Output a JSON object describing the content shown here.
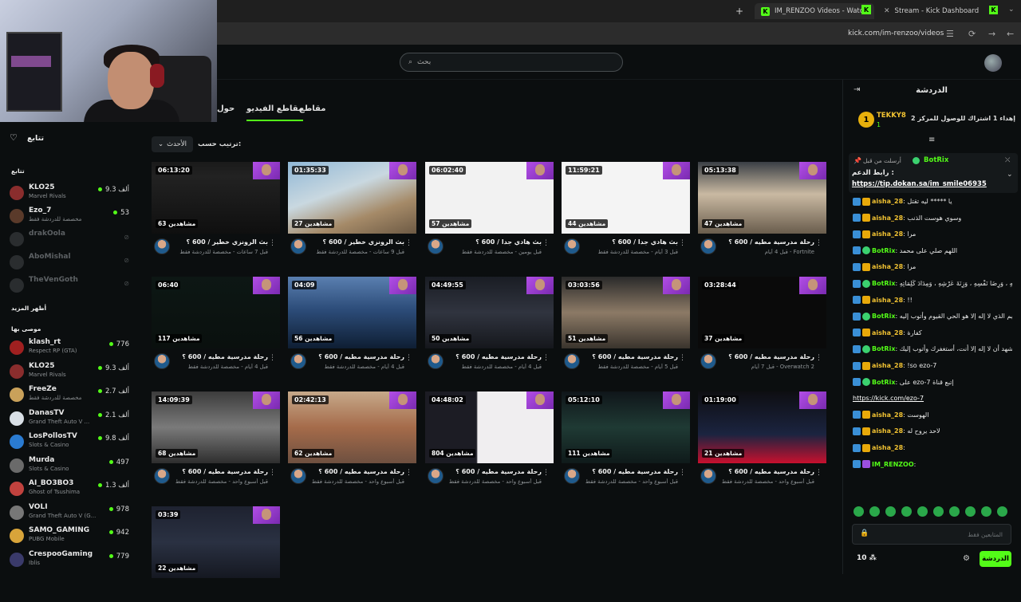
{
  "browser": {
    "tabs": [
      {
        "label": "IM_RENZOO Videos - Watch On",
        "active": true
      },
      {
        "label": "Stream - Kick Dashboard",
        "active": false
      }
    ],
    "new_tab": "+",
    "url": "kick.com/im-renzoo/videos"
  },
  "header": {
    "search_placeholder": "بحث"
  },
  "channel_tabs": {
    "about": "حول",
    "videos": "مقاطع الفيديو",
    "clips": "مقاطع"
  },
  "sort": {
    "label": "ترتيب حسب:",
    "value": "الأحدث"
  },
  "sidebar": {
    "following_title": "تتابع",
    "following_label": "تتابع",
    "show_more": "أظهر المزيد",
    "recommended_label": "موصى بها",
    "following": [
      {
        "name": "KLO25",
        "category": "Marvel Rivals",
        "viewers": "9.3 ألف",
        "live": true,
        "color": "#8a2d2d"
      },
      {
        "name": "Ezo_7",
        "category": "مخصصة للدردشة فقط",
        "viewers": "53",
        "live": true,
        "color": "#5a3a2a"
      },
      {
        "name": "drakOola",
        "category": "",
        "viewers": "",
        "live": false,
        "color": "#333"
      },
      {
        "name": "AboMishal",
        "category": "",
        "viewers": "",
        "live": false,
        "color": "#333"
      },
      {
        "name": "TheVenGoth",
        "category": "",
        "viewers": "",
        "live": false,
        "color": "#333"
      }
    ],
    "recommended": [
      {
        "name": "klash_rt",
        "category": "Respect RP (GTA)",
        "viewers": "776",
        "color": "#a02020"
      },
      {
        "name": "KLO25",
        "category": "Marvel Rivals",
        "viewers": "9.3 ألف",
        "color": "#8a2d2d"
      },
      {
        "name": "FreeZe",
        "category": "مخصصة للدردشة فقط",
        "viewers": "2.7 ألف",
        "color": "#c9a15a"
      },
      {
        "name": "DanasTV",
        "category": "Grand Theft Auto V ...",
        "viewers": "2.1 ألف",
        "color": "#d9e0e6"
      },
      {
        "name": "LosPollosTV",
        "category": "Slots & Casino",
        "viewers": "9.8 ألف",
        "color": "#2a7bd1"
      },
      {
        "name": "Murda",
        "category": "Slots & Casino",
        "viewers": "497",
        "color": "#6a6a6a"
      },
      {
        "name": "AI_BO3BO3",
        "category": "Ghost of Tsushima",
        "viewers": "1.3 ألف",
        "color": "#c1423e"
      },
      {
        "name": "VOLI",
        "category": "Grand Theft Auto V (G...",
        "viewers": "978",
        "color": "#777"
      },
      {
        "name": "SAMO_GAMING",
        "category": "PUBG Mobile",
        "viewers": "942",
        "color": "#d8a43a"
      },
      {
        "name": "CrespooGaming",
        "category": "Iblis",
        "viewers": "779",
        "color": "#3a3a6a"
      }
    ]
  },
  "videos": [
    {
      "duration": "06:13:20",
      "views": "63 مشاهدين",
      "title": "بث الرونزي خطير / 600 ؟",
      "sub": "قبل 7 ساعات - مخصصة للدردشة فقط",
      "bg": "linear-gradient(180deg,#1a1a1a 0%,#222 20%,#0f0f0f 100%)"
    },
    {
      "duration": "01:35:33",
      "views": "27 مشاهدين",
      "title": "بث الرونزي خطير / 600 ؟",
      "sub": "قبل 9 ساعات - مخصصة للدردشة فقط",
      "bg": "linear-gradient(160deg,#8fb7d6 0%,#c9d8e0 40%,#a58a68 70%,#6d5a44 100%)"
    },
    {
      "duration": "06:02:40",
      "views": "57 مشاهدين",
      "title": "بث هادي جدا / 600 ؟",
      "sub": "قبل يومين - مخصصة للدردشة فقط",
      "bg": "#f2f2f2"
    },
    {
      "duration": "11:59:21",
      "views": "44 مشاهدين",
      "title": "بث هادي جدا / 600 ؟",
      "sub": "قبل 3 أيام - مخصصة للدردشة فقط",
      "bg": "#f4f4f4"
    },
    {
      "duration": "05:13:38",
      "views": "47 مشاهدين",
      "title": "رحلة مدرسية مطيه / 600 ؟",
      "sub": "قبل 4 أيام - Fortnite",
      "bg": "linear-gradient(180deg,#3a3f45 0%,#c9b9a2 45%,#6a5d4d 100%)"
    },
    {
      "duration": "06:40",
      "views": "117 مشاهدين",
      "title": "رحلة مدرسية مطيه / 600 ؟",
      "sub": "قبل 4 أيام - مخصصة للدردشة فقط",
      "bg": "linear-gradient(180deg,#0d1714 0%,#0a100e 100%)"
    },
    {
      "duration": "04:09",
      "views": "56 مشاهدين",
      "title": "رحلة مدرسية مطيه / 600 ؟",
      "sub": "قبل 4 أيام - مخصصة للدردشة فقط",
      "bg": "linear-gradient(180deg,#5a7fb0 0%,#2d4d7a 45%,#0e1e33 100%)"
    },
    {
      "duration": "04:49:55",
      "views": "50 مشاهدين",
      "title": "رحلة مدرسية مطيه / 600 ؟",
      "sub": "قبل 4 أيام - مخصصة للدردشة فقط",
      "bg": "linear-gradient(180deg,#1a1d24 0%,#30343f 50%,#15171c 100%)"
    },
    {
      "duration": "03:03:56",
      "views": "51 مشاهدين",
      "title": "رحلة مدرسية مطيه / 600 ؟",
      "sub": "قبل 5 أيام - مخصصة للدردشة فقط",
      "bg": "linear-gradient(180deg,#2a2a2a 0%,#8c7a66 50%,#3a342d 100%)"
    },
    {
      "duration": "03:28:44",
      "views": "37 مشاهدين",
      "title": "رحلة مدرسية مطيه / 600 ؟",
      "sub": "قبل 7 أيام - Overwatch 2",
      "bg": "#0a0a0a"
    },
    {
      "duration": "14:09:39",
      "views": "68 مشاهدين",
      "title": "رحلة مدرسية مطيه / 600 ؟",
      "sub": "قبل أسبوع واحد - مخصصة للدردشة فقط",
      "bg": "linear-gradient(180deg,#3c3c3c 0%,#7a7a7a 50%,#2e2e2e 100%)"
    },
    {
      "duration": "02:42:13",
      "views": "62 مشاهدين",
      "title": "رحلة مدرسية مطيه / 600 ؟",
      "sub": "قبل أسبوع واحد - مخصصة للدردشة فقط",
      "bg": "linear-gradient(180deg,#c6a98a 0%,#a56b4a 50%,#6e5040 100%)"
    },
    {
      "duration": "04:48:02",
      "views": "804 مشاهدين",
      "title": "رحلة مدرسية مطيه / 600 ؟",
      "sub": "قبل أسبوع واحد - مخصصة للدردشة فقط",
      "bg": "linear-gradient(90deg,#1c1c24 0%,#1c1c24 40%,#f0eef0 41%,#f0eef0 100%)"
    },
    {
      "duration": "05:12:10",
      "views": "111 مشاهدين",
      "title": "رحلة مدرسية مطيه / 600 ؟",
      "sub": "قبل أسبوع واحد - مخصصة للدردشة فقط",
      "bg": "linear-gradient(180deg,#10161a 0%,#1f3a34 50%,#0f1a1a 100%)"
    },
    {
      "duration": "01:19:00",
      "views": "21 مشاهدين",
      "title": "رحلة مدرسية مطيه / 600 ؟",
      "sub": "قبل أسبوع واحد - مخصصة للدردشة فقط",
      "bg": "linear-gradient(180deg,#0e0e12 0%,#1b2440 60%,#c8102e 100%)"
    },
    {
      "duration": "03:39",
      "views": "22 مشاهدين",
      "title": "",
      "sub": "",
      "bg": "linear-gradient(180deg,#1e2230 0%,#2a3142 50%,#151821 100%)"
    }
  ],
  "chat": {
    "title": "الدردشة",
    "pinned_user": "TEKKY8",
    "pinned_rank": "1",
    "pinned_count": "1",
    "pinned_text": "إهداء 1 اشتراك للوصول للمركز 2",
    "pin_sender": "BotRix",
    "pin_sent_by": "أرسلت من قبل",
    "pin_label": "رابط الدعم :",
    "pin_link": "https://tip.dokan.sa/im_smile06935",
    "messages": [
      {
        "user": "aisha_28",
        "color": "gold",
        "text": "يا ***** ليه تقتل"
      },
      {
        "user": "aisha_28",
        "color": "gold",
        "text": "وسوي هوست الذنب"
      },
      {
        "user": "aisha_28",
        "color": "gold",
        "text": "مرا"
      },
      {
        "user": "BotRix",
        "color": "green",
        "text": "اللهم صلي على محمد"
      },
      {
        "user": "aisha_28",
        "color": "gold",
        "text": "مرا"
      },
      {
        "user": "BotRix",
        "color": "green",
        "text": "سُبْحَانَ اللهِ وَبِحَمْدِهِ ، عَدَدَ خَلْقِهِ ، وَرِضَا نَفْسِهِ ، وَزِنَةَ عَرْشِهِ ، وَمِدَادَ كَلِمَاتِهِ"
      },
      {
        "user": "aisha_28",
        "color": "gold",
        "text": "!!"
      },
      {
        "user": "BotRix",
        "color": "green",
        "text": "استغفرالله العظيم الذي لا إله إلا هو الحي القيوم وأتوب إليه"
      },
      {
        "user": "aisha_28",
        "color": "gold",
        "text": "كفارة"
      },
      {
        "user": "BotRix",
        "color": "green",
        "text": "سبحانك اللهم وبحمدك، أشهد أن لا إله إلا أنت، أستغفرك وأتوب إليك"
      },
      {
        "user": "aisha_28",
        "color": "gold",
        "text": "!so ezo-7"
      },
      {
        "user": "BotRix",
        "color": "green",
        "text": "على ezo-7 إتبع قناة"
      },
      {
        "user": "",
        "color": "link",
        "text": "https://kick.com/ezo-7"
      },
      {
        "user": "aisha_28",
        "color": "gold",
        "text": "الهوست"
      },
      {
        "user": "aisha_28",
        "color": "gold",
        "text": "لاحد يروح له"
      },
      {
        "user": "aisha_28",
        "color": "gold",
        "text": ""
      },
      {
        "user": "IM_RENZOO",
        "color": "blue",
        "text": ""
      }
    ],
    "input_placeholder": "المتابعين فقط",
    "send_label": "الدردشة",
    "points": "10"
  }
}
